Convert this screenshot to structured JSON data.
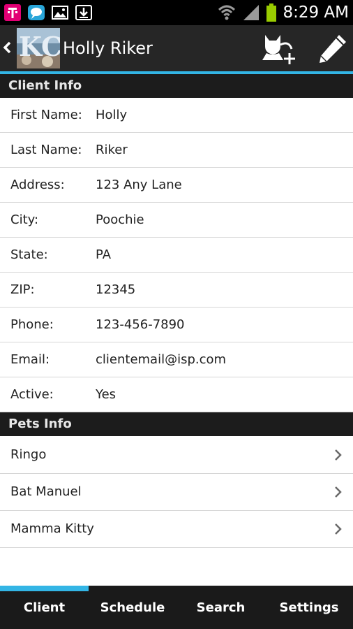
{
  "status_bar": {
    "time": "8:29 AM",
    "icons": [
      "tmobile-icon",
      "chat-icon",
      "gallery-icon",
      "download-icon",
      "wifi-icon",
      "signal-icon",
      "battery-icon"
    ]
  },
  "action_bar": {
    "logo_text": "KC",
    "title": "Holly Riker",
    "actions": [
      "add-pet-icon",
      "edit-icon"
    ]
  },
  "client_section": {
    "header": "Client Info",
    "fields": [
      {
        "label": "First Name:",
        "value": "Holly"
      },
      {
        "label": "Last Name:",
        "value": "Riker"
      },
      {
        "label": "Address:",
        "value": "123 Any Lane"
      },
      {
        "label": "City:",
        "value": "Poochie"
      },
      {
        "label": "State:",
        "value": "PA"
      },
      {
        "label": "ZIP:",
        "value": "12345"
      },
      {
        "label": "Phone:",
        "value": "123-456-7890"
      },
      {
        "label": "Email:",
        "value": "clientemail@isp.com"
      },
      {
        "label": "Active:",
        "value": "Yes"
      }
    ]
  },
  "pets_section": {
    "header": "Pets Info",
    "pets": [
      "Ringo",
      "Bat Manuel",
      "Mamma Kitty"
    ]
  },
  "tabs": {
    "items": [
      "Client",
      "Schedule",
      "Search",
      "Settings"
    ],
    "selected": "Client"
  },
  "colors": {
    "accent": "#33b5e5",
    "battery": "#99cc00",
    "tmobile": "#e20074"
  }
}
